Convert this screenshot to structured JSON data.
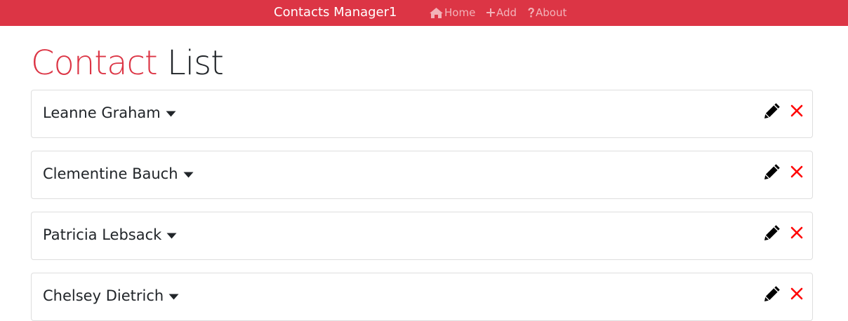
{
  "navbar": {
    "brand": "Contacts Manager1",
    "links": [
      {
        "label": "Home",
        "icon": "home-icon"
      },
      {
        "label": "Add",
        "icon": "plus-icon"
      },
      {
        "label": "About",
        "icon": "question-icon"
      }
    ],
    "background": "#dc3545"
  },
  "page": {
    "title_accent": "Contact",
    "title_rest": "List",
    "accent_color": "#dc3545"
  },
  "contacts": [
    {
      "name": "Leanne Graham"
    },
    {
      "name": "Clementine Bauch"
    },
    {
      "name": "Patricia Lebsack"
    },
    {
      "name": "Chelsey Dietrich"
    }
  ],
  "icons": {
    "toggle": "caret-down-icon",
    "edit": "pencil-icon",
    "delete": "times-icon",
    "delete_color": "#ff0000"
  }
}
